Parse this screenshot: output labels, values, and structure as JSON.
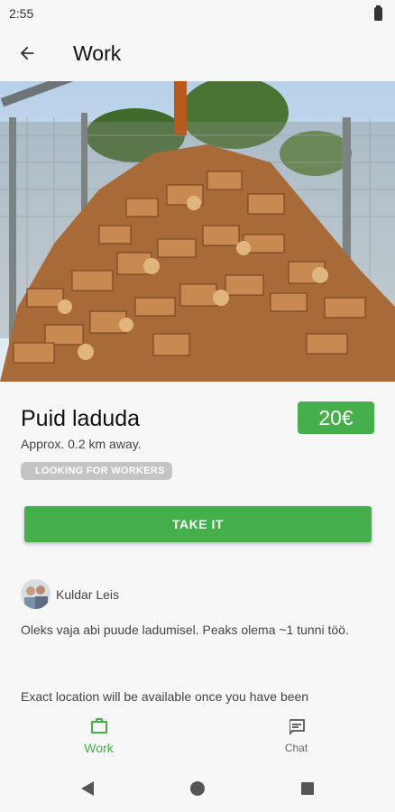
{
  "status_bar": {
    "time": "2:55"
  },
  "app_bar": {
    "title": "Work",
    "back_icon": "arrow-back-icon"
  },
  "job": {
    "title": "Puid laduda",
    "price": "20€",
    "distance": "Approx. 0.2 km away.",
    "status": "LOOKING FOR WORKERS",
    "action_label": "TAKE IT",
    "author": "Kuldar Leis",
    "description": "Oleks vaja abi puude ladumisel. Peaks olema ~1 tunni töö.",
    "location_note": "Exact location will be available once you have been"
  },
  "bottom_nav": {
    "items": [
      {
        "label": "Work",
        "icon": "briefcase-icon",
        "active": true
      },
      {
        "label": "Chat",
        "icon": "chat-bubble-icon",
        "active": false
      }
    ]
  },
  "system_nav": {
    "back": "back-triangle-icon",
    "home": "home-circle-icon",
    "recents": "recents-square-icon"
  },
  "colors": {
    "accent": "#45b04b",
    "chip": "#c4c4c4",
    "background": "#f7f7f7"
  }
}
